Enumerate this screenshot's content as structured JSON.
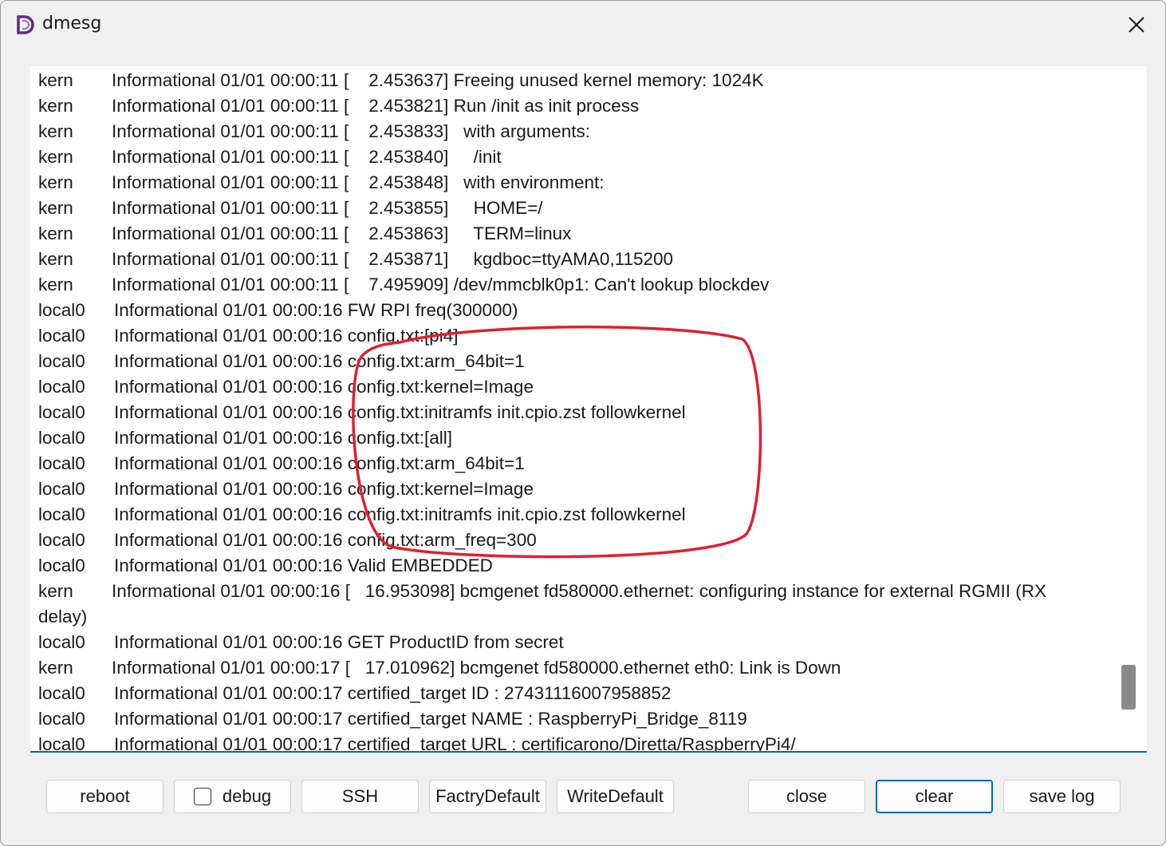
{
  "window": {
    "title": "dmesg"
  },
  "log": {
    "lines": [
      {
        "facility": "kern",
        "text": "Informational 01/01 00:00:11 [    2.453637] Freeing unused kernel memory: 1024K"
      },
      {
        "facility": "kern",
        "text": "Informational 01/01 00:00:11 [    2.453821] Run /init as init process"
      },
      {
        "facility": "kern",
        "text": "Informational 01/01 00:00:11 [    2.453833]   with arguments:"
      },
      {
        "facility": "kern",
        "text": "Informational 01/01 00:00:11 [    2.453840]     /init"
      },
      {
        "facility": "kern",
        "text": "Informational 01/01 00:00:11 [    2.453848]   with environment:"
      },
      {
        "facility": "kern",
        "text": "Informational 01/01 00:00:11 [    2.453855]     HOME=/"
      },
      {
        "facility": "kern",
        "text": "Informational 01/01 00:00:11 [    2.453863]     TERM=linux"
      },
      {
        "facility": "kern",
        "text": "Informational 01/01 00:00:11 [    2.453871]     kgdboc=ttyAMA0,115200"
      },
      {
        "facility": "kern",
        "text": "Informational 01/01 00:00:11 [    7.495909] /dev/mmcblk0p1: Can't lookup blockdev"
      },
      {
        "facility": "local0",
        "text": "Informational 01/01 00:00:16 FW RPI freq(300000)"
      },
      {
        "facility": "local0",
        "text": "Informational 01/01 00:00:16 config.txt:[pi4]"
      },
      {
        "facility": "local0",
        "text": "Informational 01/01 00:00:16 config.txt:arm_64bit=1"
      },
      {
        "facility": "local0",
        "text": "Informational 01/01 00:00:16 config.txt:kernel=Image"
      },
      {
        "facility": "local0",
        "text": "Informational 01/01 00:00:16 config.txt:initramfs init.cpio.zst followkernel"
      },
      {
        "facility": "local0",
        "text": "Informational 01/01 00:00:16 config.txt:[all]"
      },
      {
        "facility": "local0",
        "text": "Informational 01/01 00:00:16 config.txt:arm_64bit=1"
      },
      {
        "facility": "local0",
        "text": "Informational 01/01 00:00:16 config.txt:kernel=Image"
      },
      {
        "facility": "local0",
        "text": "Informational 01/01 00:00:16 config.txt:initramfs init.cpio.zst followkernel"
      },
      {
        "facility": "local0",
        "text": "Informational 01/01 00:00:16 config.txt:arm_freq=300"
      },
      {
        "facility": "local0",
        "text": "Informational 01/01 00:00:16 Valid EMBEDDED"
      },
      {
        "facility": "kern",
        "text": "Informational 01/01 00:00:16 [   16.953098] bcmgenet fd580000.ethernet: configuring instance for external RGMII (RX",
        "wrap": "delay)"
      },
      {
        "facility": "local0",
        "text": "Informational 01/01 00:00:16 GET ProductID from secret"
      },
      {
        "facility": "kern",
        "text": "Informational 01/01 00:00:17 [   17.010962] bcmgenet fd580000.ethernet eth0: Link is Down"
      },
      {
        "facility": "local0",
        "text": "Informational 01/01 00:00:17 certified_target ID : 27431116007958852"
      },
      {
        "facility": "local0",
        "text": "Informational 01/01 00:00:17 certified_target NAME : RaspberryPi_Bridge_8119"
      },
      {
        "facility": "local0",
        "text": "Informational 01/01 00:00:17 certified_target URL : certificarono/Diretta/RaspberryPi4/"
      }
    ]
  },
  "buttons": {
    "reboot": "reboot",
    "debug": "debug",
    "ssh": "SSH",
    "factory_default": "FactryDefault",
    "write_default": "WriteDefault",
    "close": "close",
    "clear": "clear",
    "save_log": "save log"
  },
  "debug_checked": false,
  "colors": {
    "annotation": "#e0202e",
    "accent": "#0067c0",
    "icon": "#5a2a8a"
  }
}
